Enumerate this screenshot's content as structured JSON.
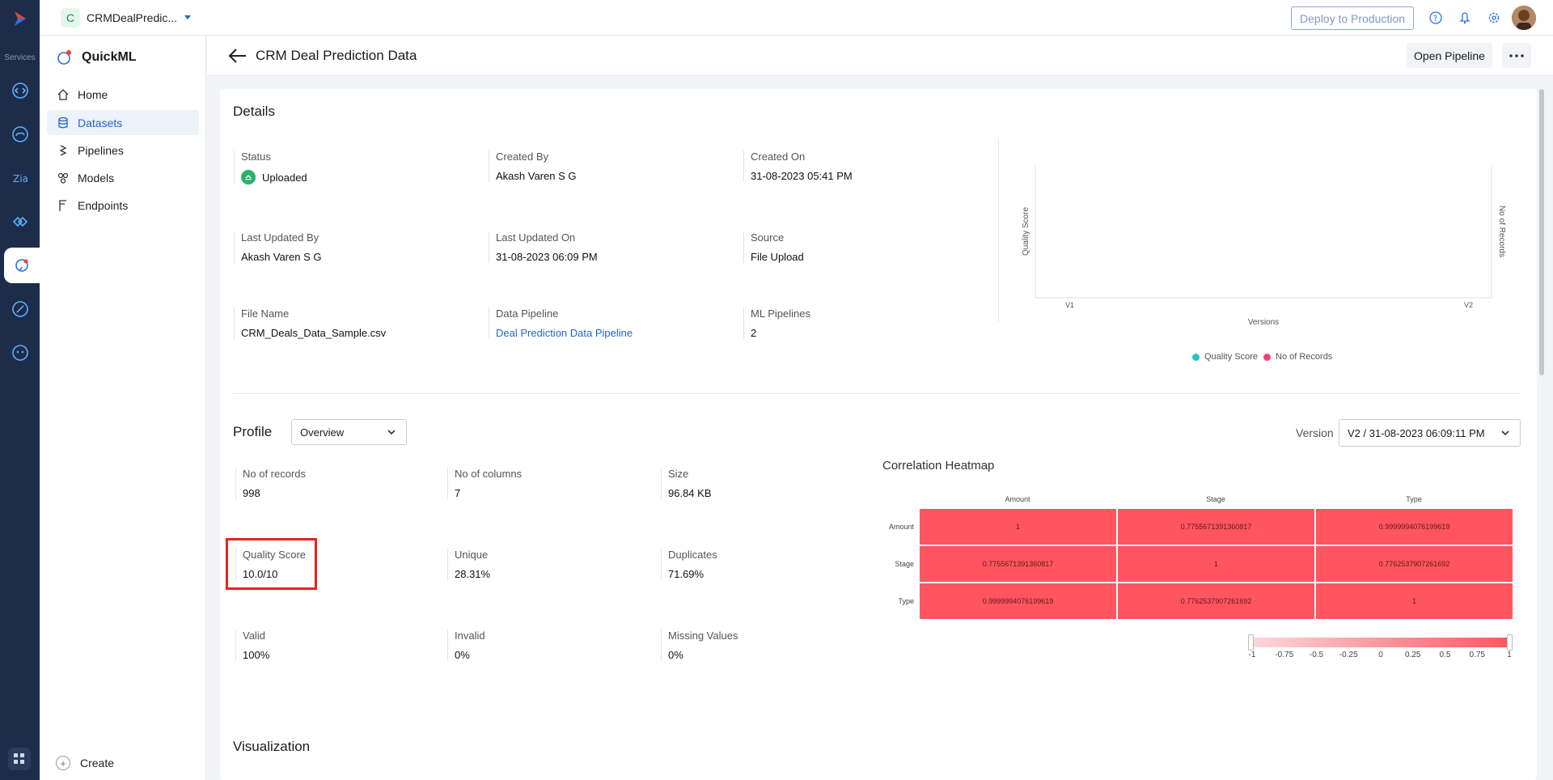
{
  "rail": {
    "services_label": "Services",
    "icons": [
      "catalyst-logo-icon",
      "code-icon",
      "cloud-icon",
      "zia-icon",
      "integration-icon",
      "quickml-icon",
      "rocket-icon",
      "bot-icon",
      "apps-grid-icon"
    ]
  },
  "topbar": {
    "project_badge": "C",
    "project_name": "CRMDealPredic...",
    "deploy_label": "Deploy to Production"
  },
  "sidenav": {
    "brand": "QuickML",
    "items": [
      {
        "label": "Home",
        "icon": "home-icon"
      },
      {
        "label": "Datasets",
        "icon": "database-icon",
        "active": true
      },
      {
        "label": "Pipelines",
        "icon": "pipeline-icon"
      },
      {
        "label": "Models",
        "icon": "models-icon"
      },
      {
        "label": "Endpoints",
        "icon": "endpoint-icon"
      }
    ],
    "create_label": "Create"
  },
  "header": {
    "title": "CRM Deal Prediction Data",
    "open_pipeline_label": "Open Pipeline"
  },
  "details": {
    "heading": "Details",
    "fields": [
      {
        "label": "Status",
        "value": "Uploaded"
      },
      {
        "label": "Created By",
        "value": "Akash Varen S G"
      },
      {
        "label": "Created On",
        "value": "31-08-2023 05:41 PM"
      },
      {
        "label": "Last Updated By",
        "value": "Akash Varen S G"
      },
      {
        "label": "Last Updated On",
        "value": "31-08-2023 06:09 PM"
      },
      {
        "label": "Source",
        "value": "File Upload"
      },
      {
        "label": "File Name",
        "value": "CRM_Deals_Data_Sample.csv"
      },
      {
        "label": "Data Pipeline",
        "value": "Deal Prediction Data Pipeline"
      },
      {
        "label": "ML Pipelines",
        "value": "2"
      }
    ]
  },
  "chart_data": {
    "type": "line",
    "categories": [
      "V1",
      "V2"
    ],
    "xlabel": "Versions",
    "ylabel": "Quality Score",
    "y2label": "No of Records",
    "series": [
      {
        "name": "Quality Score",
        "color": "#1ec8c8",
        "values": []
      },
      {
        "name": "No of Records",
        "color": "#ff3d7f",
        "values": []
      }
    ],
    "legend": "bottom"
  },
  "profile": {
    "heading": "Profile",
    "view_select": "Overview",
    "version_label": "Version",
    "version_select": "V2 / 31-08-2023 06:09:11 PM",
    "stats": [
      {
        "label": "No of records",
        "value": "998"
      },
      {
        "label": "No of columns",
        "value": "7"
      },
      {
        "label": "Size",
        "value": "96.84 KB"
      },
      {
        "label": "Quality Score",
        "value": "10.0/10"
      },
      {
        "label": "Unique",
        "value": "28.31%"
      },
      {
        "label": "Duplicates",
        "value": "71.69%"
      },
      {
        "label": "Valid",
        "value": "100%"
      },
      {
        "label": "Invalid",
        "value": "0%"
      },
      {
        "label": "Missing Values",
        "value": "0%"
      }
    ]
  },
  "heatmap": {
    "title": "Correlation Heatmap",
    "columns": [
      "Amount",
      "Stage",
      "Type"
    ],
    "rows": [
      "Amount",
      "Stage",
      "Type"
    ],
    "values": [
      [
        "1",
        "0.7755671391360817",
        "0.9999994076199619"
      ],
      [
        "0.7755671391360817",
        "1",
        "0.7762537907261692"
      ],
      [
        "0.9999994076199619",
        "0.7762537907261692",
        "1"
      ]
    ],
    "color_scale": {
      "min_color": "#ffd9dc",
      "max_color": "#ff5560"
    },
    "scale_ticks": [
      "-1",
      "-0.75",
      "-0.5",
      "-0.25",
      "0",
      "0.25",
      "0.5",
      "0.75",
      "1"
    ]
  },
  "visualization": {
    "heading": "Visualization"
  }
}
